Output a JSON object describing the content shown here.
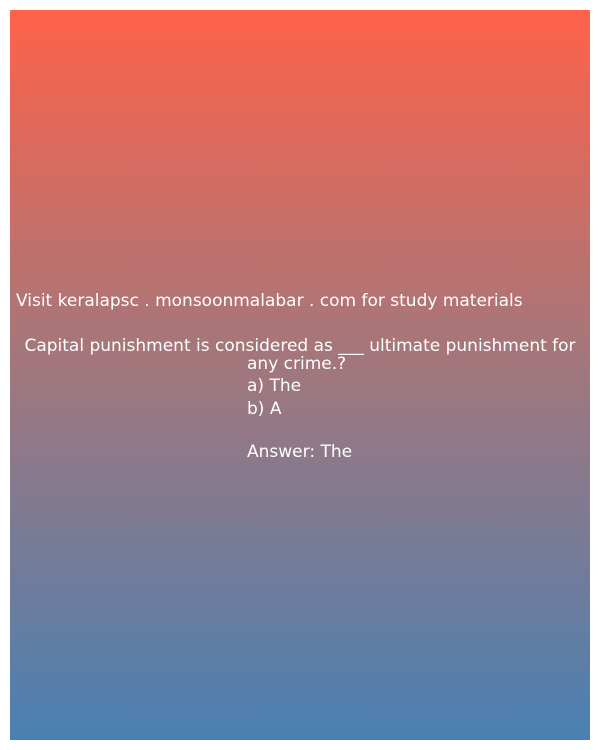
{
  "promo_text": "Visit keralapsc . monsoonmalabar . com for study materials",
  "question": {
    "line1": "Capital punishment is considered as ___ ultimate punishment for",
    "line2": "any crime.?"
  },
  "options": [
    {
      "label": "a) The"
    },
    {
      "label": "b) A"
    }
  ],
  "answer": "Answer: The",
  "colors": {
    "gradient_top": "#ff624a",
    "gradient_bottom": "#4a80b2",
    "text": "#ffffff"
  }
}
